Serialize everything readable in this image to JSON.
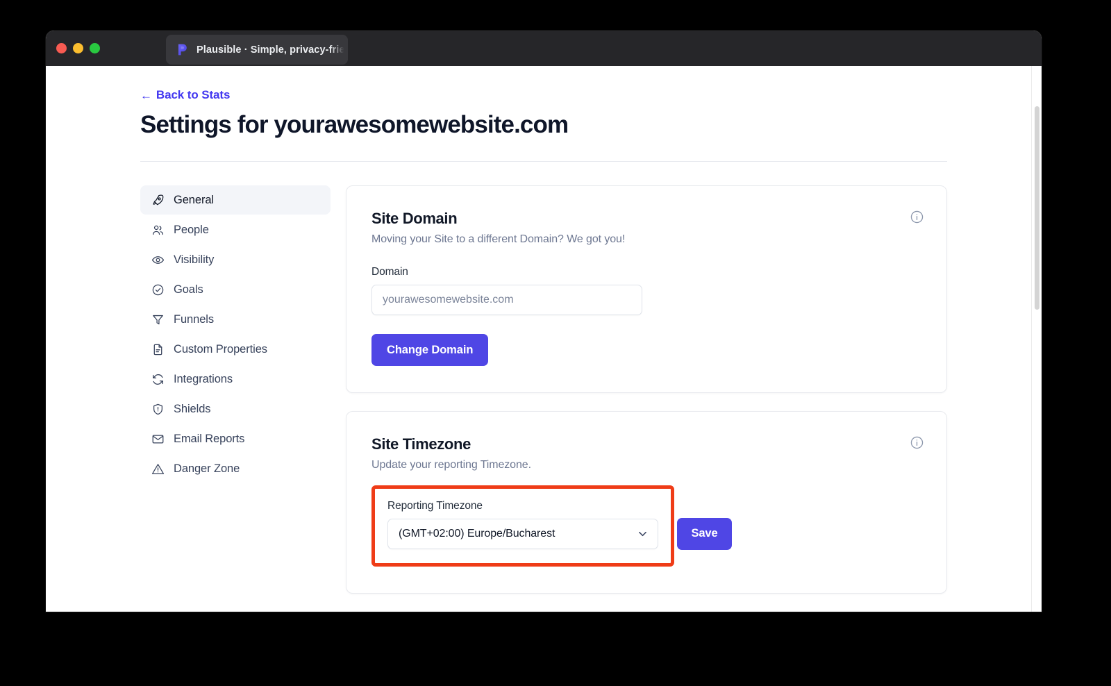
{
  "window": {
    "traffic_lights": [
      {
        "name": "close",
        "color": "#f85b52"
      },
      {
        "name": "minimize",
        "color": "#fbbe2f"
      },
      {
        "name": "maximize",
        "color": "#29c840"
      }
    ],
    "tab": {
      "title": "Plausible · Simple, privacy-frien",
      "favicon": "plausible-logo-icon"
    }
  },
  "header": {
    "back_link": "Back to Stats",
    "back_arrow": "←",
    "title": "Settings for yourawesomewebsite.com"
  },
  "sidebar": {
    "items": [
      {
        "label": "General",
        "icon": "rocket-icon",
        "active": true
      },
      {
        "label": "People",
        "icon": "people-icon",
        "active": false
      },
      {
        "label": "Visibility",
        "icon": "eye-icon",
        "active": false
      },
      {
        "label": "Goals",
        "icon": "check-circle-icon",
        "active": false
      },
      {
        "label": "Funnels",
        "icon": "funnel-icon",
        "active": false
      },
      {
        "label": "Custom Properties",
        "icon": "document-icon",
        "active": false
      },
      {
        "label": "Integrations",
        "icon": "sync-icon",
        "active": false
      },
      {
        "label": "Shields",
        "icon": "shield-alert-icon",
        "active": false
      },
      {
        "label": "Email Reports",
        "icon": "envelope-icon",
        "active": false
      },
      {
        "label": "Danger Zone",
        "icon": "warning-triangle-icon",
        "active": false
      }
    ]
  },
  "cards": {
    "site_domain": {
      "title": "Site Domain",
      "subtitle": "Moving your Site to a different Domain? We got you!",
      "info_icon": "info-circle-icon",
      "field_label": "Domain",
      "input_placeholder": "yourawesomewebsite.com",
      "input_value": "",
      "button_label": "Change Domain"
    },
    "site_timezone": {
      "title": "Site Timezone",
      "subtitle": "Update your reporting Timezone.",
      "info_icon": "info-circle-icon",
      "field_label": "Reporting Timezone",
      "select_value": "(GMT+02:00) Europe/Bucharest",
      "select_chevron": "chevron-down-icon",
      "button_label": "Save",
      "highlighted": true
    }
  },
  "colors": {
    "accent": "#4f46e5",
    "link": "#4338f0",
    "annotation_highlight": "#ef3c17",
    "title_bar": "#262629",
    "tab_active": "#38383c",
    "sidebar_active_bg": "#f3f5f9",
    "page_background": "#000000"
  }
}
